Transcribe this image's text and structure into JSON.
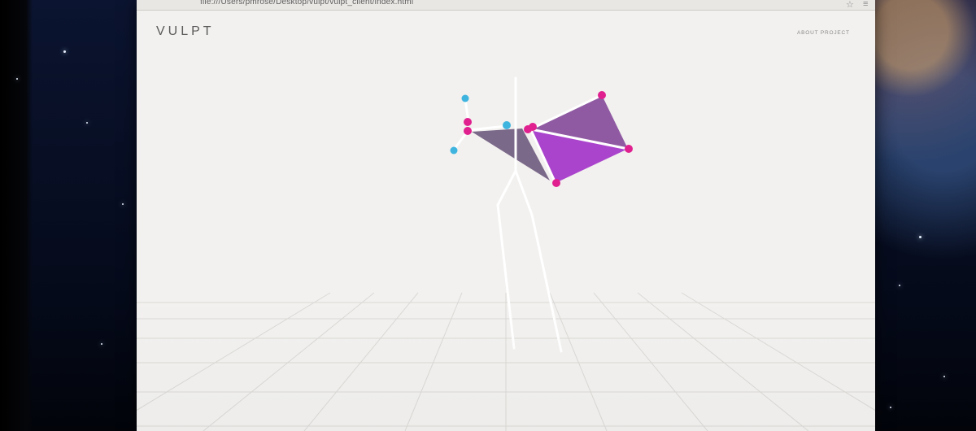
{
  "browser": {
    "url": "file:///Users/pmrose/Desktop/vulpt/vulpt_client/index.html",
    "icons": [
      "star-icon",
      "menu-icon"
    ]
  },
  "app": {
    "brand": "VULPT",
    "about_label": "ABOUT PROJECT"
  },
  "scene": {
    "joint_colors": {
      "joint": "#e0208f",
      "hand": "#3fb4df"
    },
    "face_colors": {
      "upper": "#8e5aa0",
      "lower": "#a545c8",
      "left": "#6a5a78"
    },
    "skeleton_color": "#ffffff",
    "grid_color": "#d9d8d5"
  }
}
